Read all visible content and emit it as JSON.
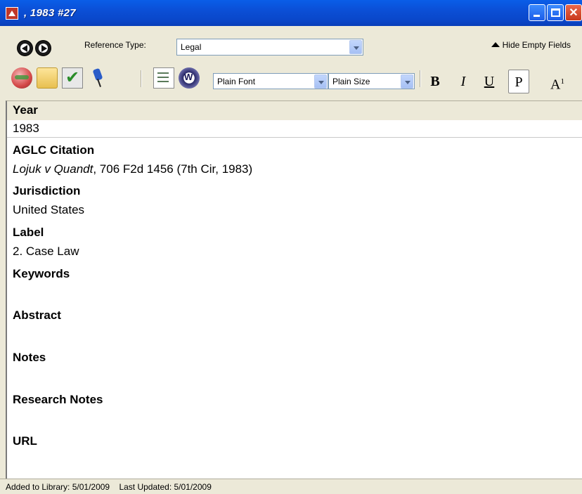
{
  "window": {
    "title": ", 1983 #27",
    "icon": "app-icon",
    "buttons": [
      "minimize-icon",
      "maximize-icon",
      "close-icon"
    ]
  },
  "toolbar1": {
    "back_icon": "back-arrow-icon",
    "forward_icon": "forward-arrow-icon",
    "reference_type_label": "Reference Type:",
    "reference_type_value": "Legal",
    "hide_empty_label": "Hide Empty Fields",
    "hide_empty_icon": "up-arrow-icon"
  },
  "toolbar2": {
    "icons": [
      "globe-icon",
      "folder-icon",
      "checkmark-icon",
      "pushpin-icon",
      "list-icon",
      "word-icon"
    ],
    "font_value": "Plain Font",
    "size_value": "Plain Size",
    "bold_label": "B",
    "italic_label": "I",
    "underline_label": "U",
    "plain_label": "P",
    "superscript_label": "A",
    "superscript_sup": "1"
  },
  "fields": {
    "year_label": "Year",
    "year_value": "1983",
    "citation_label": "AGLC Citation",
    "citation_case": "Lojuk v Quandt",
    "citation_rest": ", 706 F2d 1456 (7th Cir, 1983)",
    "jurisdiction_label": "Jurisdiction",
    "jurisdiction_value": "United States",
    "label_label": "Label",
    "label_value": "2. Case Law",
    "keywords_label": "Keywords",
    "abstract_label": "Abstract",
    "notes_label": "Notes",
    "research_notes_label": "Research Notes",
    "url_label": "URL"
  },
  "status": {
    "text": "Added to Library: 5/01/2009    Last Updated: 5/01/2009"
  },
  "colors": {
    "titlebar": "#0b4fd6",
    "close_button": "#c8381c",
    "chrome": "#ece9d8"
  }
}
